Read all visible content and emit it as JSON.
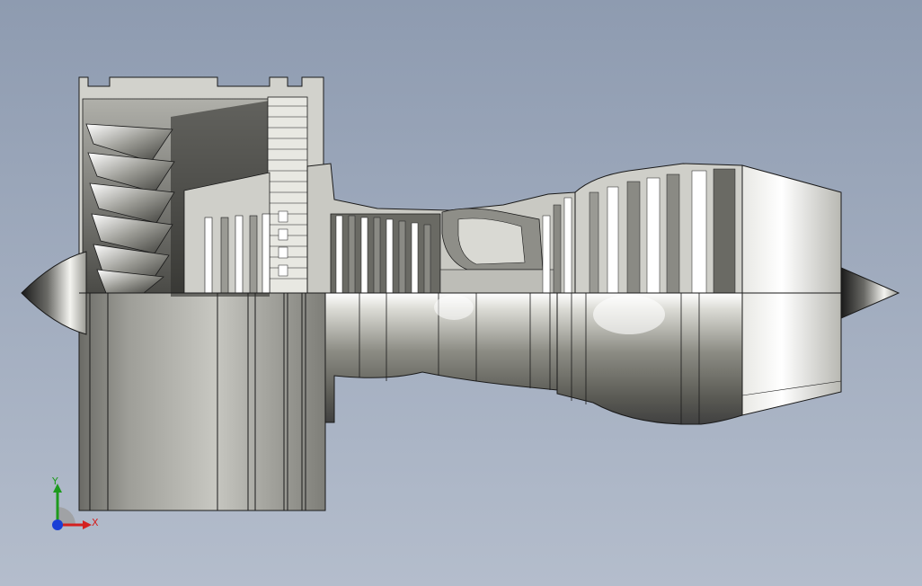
{
  "viewport": {
    "background_top": "#8e9bb0",
    "background_bottom": "#b4bdcc"
  },
  "model": {
    "subject": "turbofan-engine-section-view",
    "edge_color": "#1a1a1a",
    "metal_light": "#f2f2ef",
    "metal_dark": "#3a3a36"
  },
  "triad": {
    "y_label": "Y",
    "x_label": "X",
    "y_color": "#1d9a1d",
    "x_color": "#d42020",
    "z_color": "#1a3fd6"
  }
}
